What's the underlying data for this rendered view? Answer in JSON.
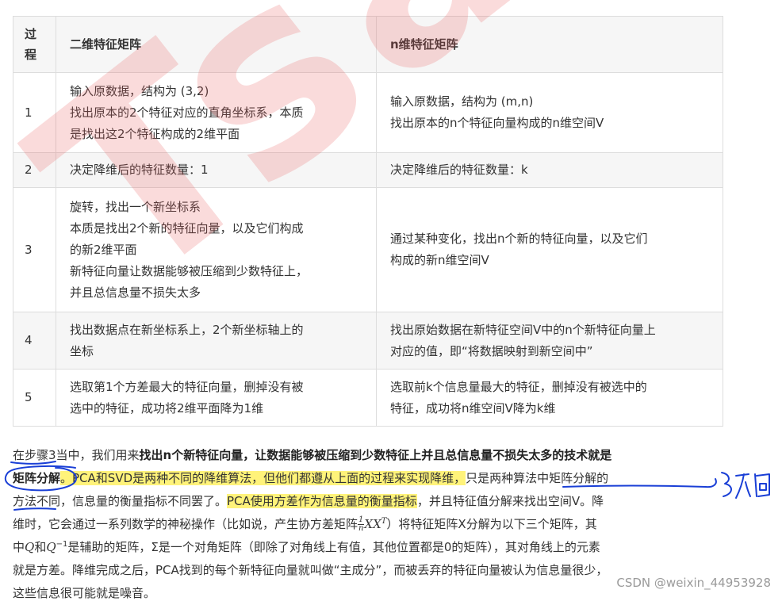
{
  "table": {
    "headers": [
      "过\n程",
      "二维特征矩阵",
      "n维特征矩阵"
    ],
    "rows": [
      {
        "step": "1",
        "two_d": [
          "输入原数据，结构为 (3,2)",
          "找出原本的2个特征对应的直角坐标系，本质",
          "是找出这2个特征构成的2维平面"
        ],
        "n_d": [
          "输入原数据，结构为 (m,n)",
          "找出原本的n个特征向量构成的n维空间V"
        ]
      },
      {
        "step": "2",
        "two_d": [
          "决定降维后的特征数量：1"
        ],
        "n_d": [
          "决定降维后的特征数量：k"
        ]
      },
      {
        "step": "3",
        "two_d": [
          "旋转，找出一个新坐标系",
          "本质是找出2个新的特征向量，以及它们构成",
          "的新2维平面",
          "新特征向量让数据能够被压缩到少数特征上，",
          "并且总信息量不损失太多"
        ],
        "n_d": [
          "通过某种变化，找出n个新的特征向量，以及它们",
          "构成的新n维空间V"
        ]
      },
      {
        "step": "4",
        "two_d": [
          "找出数据点在新坐标系上，2个新坐标轴上的",
          "坐标"
        ],
        "n_d": [
          "找出原始数据在新特征空间V中的n个新特征向量上",
          "对应的值，即“将数据映射到新空间中”"
        ]
      },
      {
        "step": "5",
        "two_d": [
          "选取第1个方差最大的特征向量，删掉没有被",
          "选中的特征，成功将2维平面降为1维"
        ],
        "n_d": [
          "选取前k个信息量最大的特征，删掉没有被选中的",
          "特征，成功将n维空间V降为k维"
        ]
      }
    ]
  },
  "paragraph": {
    "l1_a": "在步骤3当中，我们用来",
    "l1_b": "找出n个新特征向量，让数据能够被压缩到少数特征上并且总信息量不损失太多的技术就是",
    "l2_a": "矩阵分解",
    "l2_b": "。PCA和SVD是两种不同的降维算法，但他们都遵从上面的过程来实现降维，",
    "l2_c": "只是两种算法中矩阵分解的",
    "l3_a": "方法不同，信息量的衡量指标不同罢了。",
    "l3_b": "PCA使用方差作为信息量的衡量指标",
    "l3_c": "，并且特征值分解来找出空间V。降",
    "l4_a": "维时，它会通过一系列数学的神秘操作（比如说，产生协方差矩阵",
    "l4_frac_num": "1",
    "l4_frac_den": "n",
    "l4_math": "XX",
    "l4_sup": "T",
    "l4_b": "）将特征矩阵X分解为以下三个矩阵，其",
    "l5_a": "中",
    "l5_q": "Q",
    "l5_b": "和",
    "l5_q2": "Q",
    "l5_sup": "−1",
    "l5_c": "是辅助的矩阵，Σ是一个对角矩阵（即除了对角线上有值，其他位置都是0的矩阵），其对角线上的元素",
    "l6": "就是方差。降维完成之后，PCA找到的每个新特征向量就叫做“主成分”，而被丢弃的特征向量被认为信息量很少，",
    "l7": "这些信息很可能就是噪音。"
  },
  "watermark": "TsaiT",
  "credit": "CSDN @weixin_44953928",
  "colors": {
    "highlight": "#fff37a",
    "ink": "#1a3fd6",
    "watermark": "#e65a5a"
  }
}
